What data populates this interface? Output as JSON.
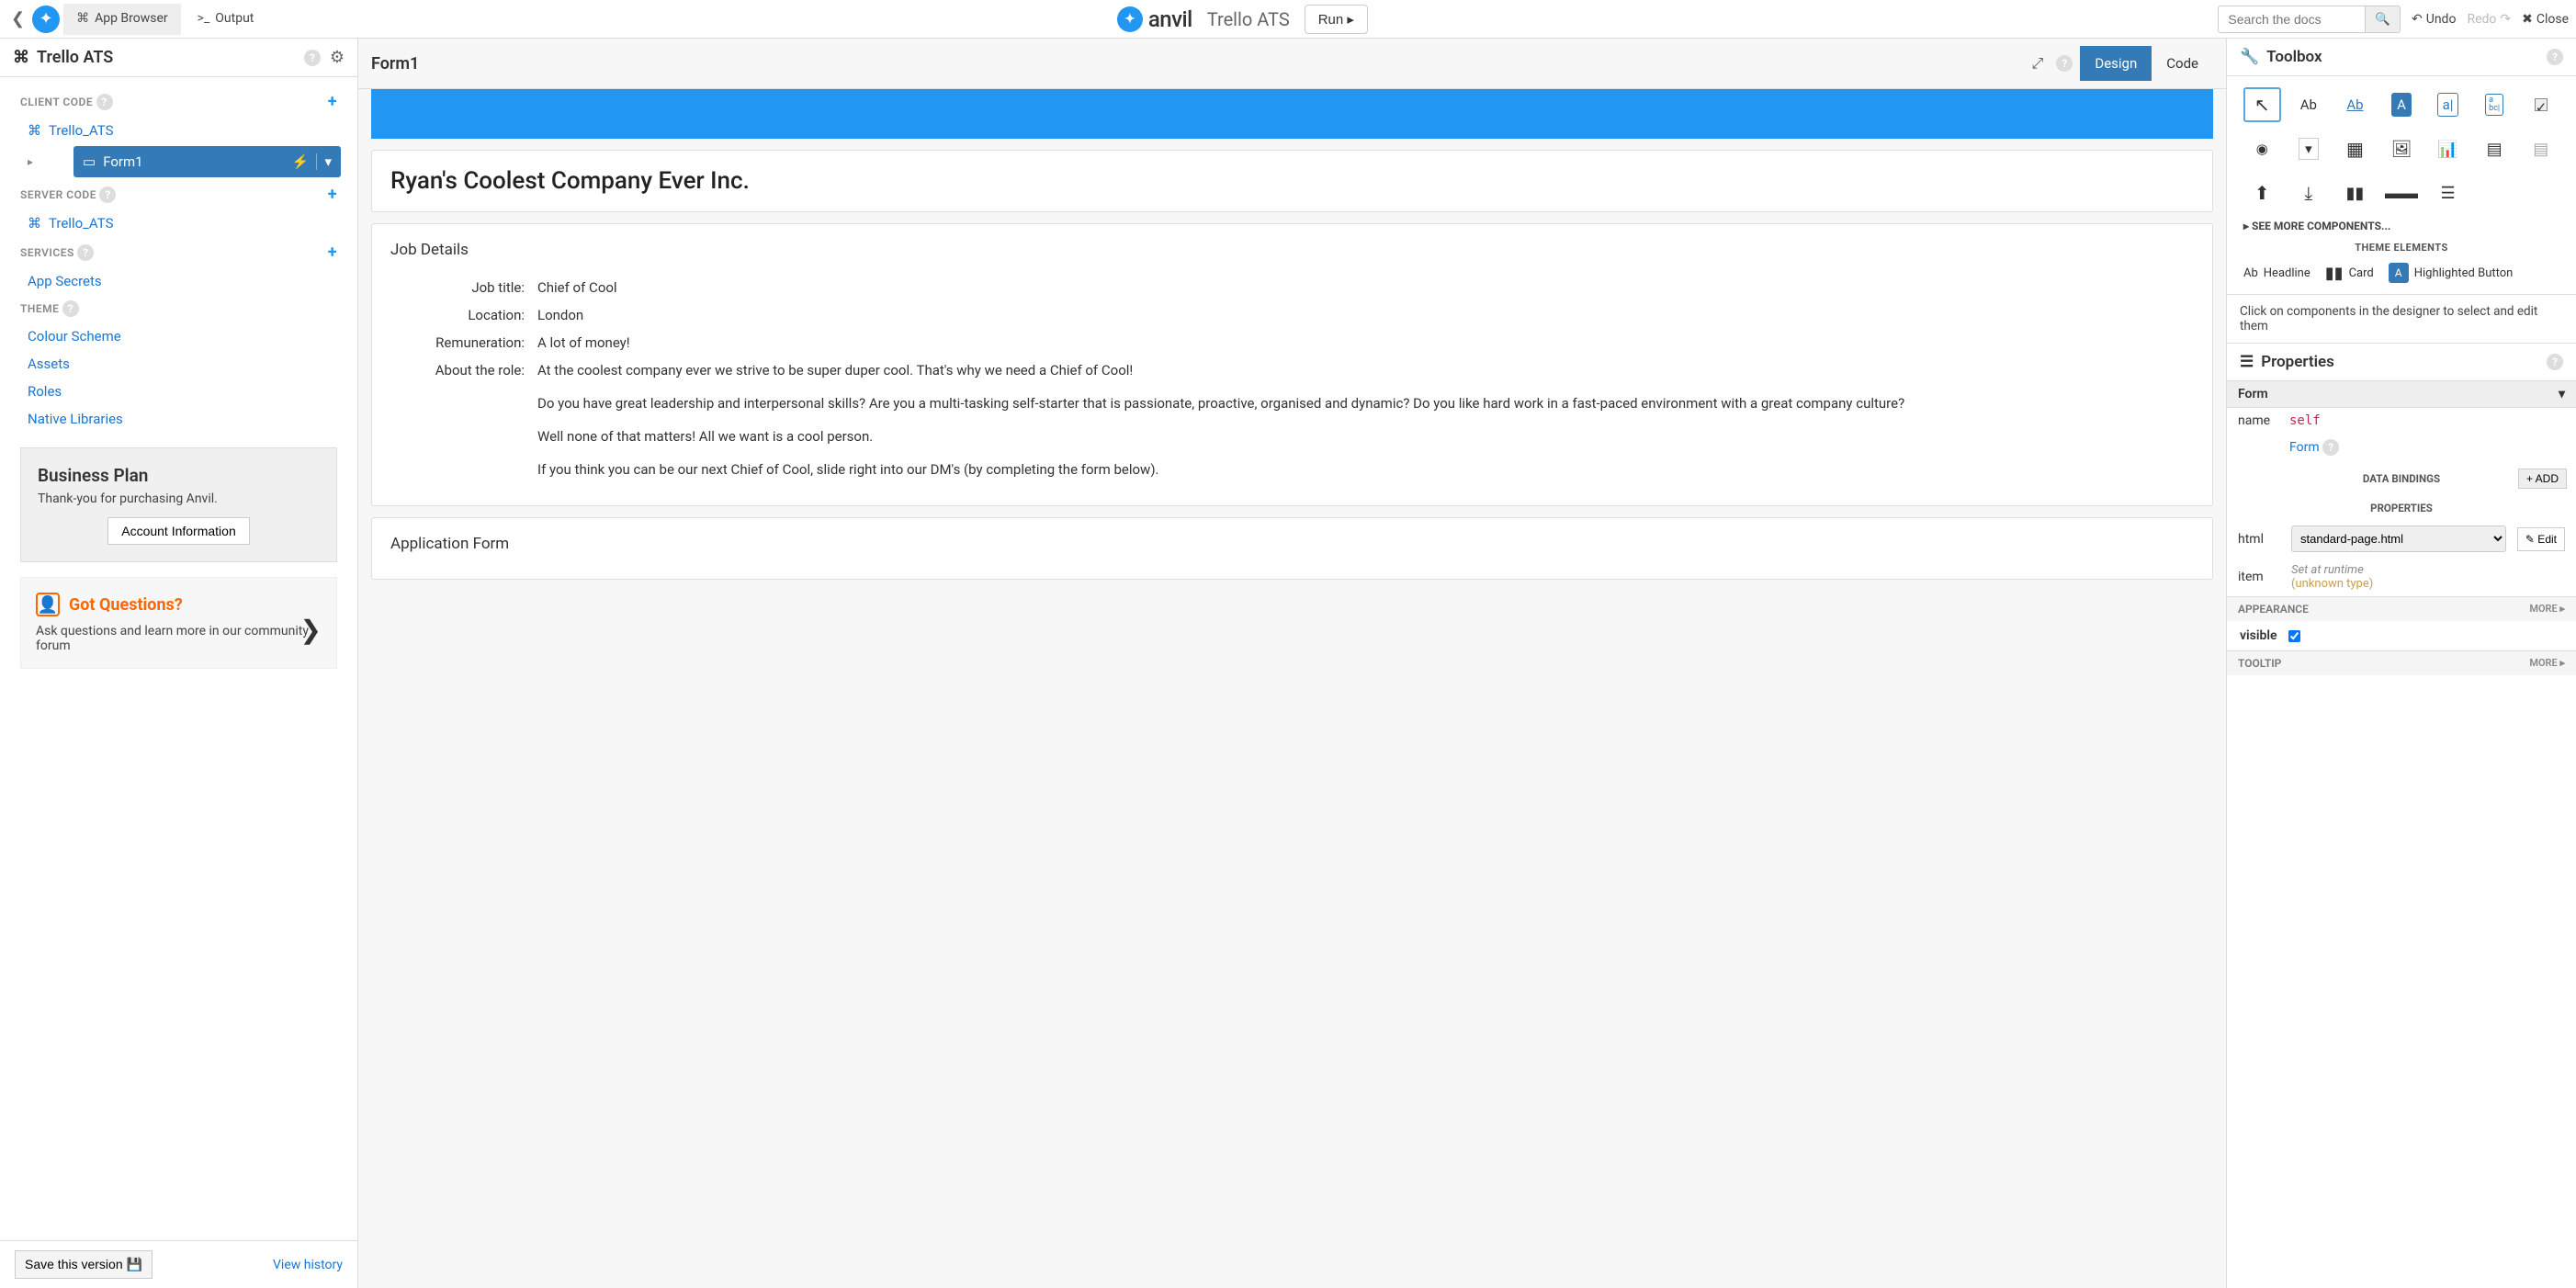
{
  "topbar": {
    "app_browser": "App Browser",
    "output": "Output",
    "brand": "anvil",
    "app_name": "Trello ATS",
    "run": "Run ▸",
    "search_placeholder": "Search the docs",
    "undo": "Undo",
    "redo": "Redo",
    "close": "Close"
  },
  "sidebar": {
    "title": "Trello ATS",
    "sections": {
      "client_code": "CLIENT CODE",
      "server_code": "SERVER CODE",
      "services": "SERVICES",
      "theme": "THEME"
    },
    "client_items": {
      "trello_ats": "Trello_ATS",
      "form1": "Form1"
    },
    "server_items": {
      "trello_ats": "Trello_ATS"
    },
    "services_items": {
      "app_secrets": "App Secrets"
    },
    "theme_items": {
      "colour_scheme": "Colour Scheme",
      "assets": "Assets",
      "roles": "Roles",
      "native_libraries": "Native Libraries"
    },
    "plan": {
      "title": "Business Plan",
      "sub": "Thank-you for purchasing Anvil.",
      "button": "Account Information"
    },
    "questions": {
      "title": "Got Questions?",
      "sub": "Ask questions and learn more in our community forum"
    },
    "save": "Save this version",
    "history": "View history"
  },
  "center": {
    "title": "Form1",
    "design": "Design",
    "code": "Code",
    "company": "Ryan's Coolest Company Ever Inc.",
    "job_details": "Job Details",
    "labels": {
      "title": "Job title:",
      "location": "Location:",
      "remuneration": "Remuneration:",
      "about": "About the role:"
    },
    "values": {
      "title": "Chief of Cool",
      "location": "London",
      "remuneration": "A lot of money!",
      "about": "At the coolest company ever we strive to be super duper cool. That's why we need a Chief of Cool!\n\nDo you have great leadership and interpersonal skills? Are you a multi-tasking self-starter that is passionate, proactive, organised and dynamic? Do you like hard work in a fast-paced environment with a great company culture?\n\nWell none of that matters! All we want is a cool person.\n\nIf you think you can be our next Chief of Cool, slide right into our DM's (by completing the form below)."
    },
    "application_form": "Application Form"
  },
  "toolbox": {
    "title": "Toolbox",
    "see_more": "▸ SEE MORE COMPONENTS...",
    "theme_elements": "THEME ELEMENTS",
    "headline": "Headline",
    "card": "Card",
    "highlighted_button": "Highlighted Button",
    "hint": "Click on components in the designer to select and edit them"
  },
  "properties": {
    "title": "Properties",
    "form": "Form",
    "name_label": "name",
    "name_val": "self",
    "form_link": "Form",
    "data_bindings": "DATA BINDINGS",
    "add": "+ ADD",
    "properties_hdr": "PROPERTIES",
    "html_label": "html",
    "html_val": "standard-page.html",
    "edit": "✎ Edit",
    "item_label": "item",
    "set_runtime": "Set at runtime",
    "unknown_type": "(unknown type)",
    "appearance": "APPEARANCE",
    "more": "MORE ▸",
    "visible": "visible",
    "tooltip": "TOOLTIP"
  }
}
